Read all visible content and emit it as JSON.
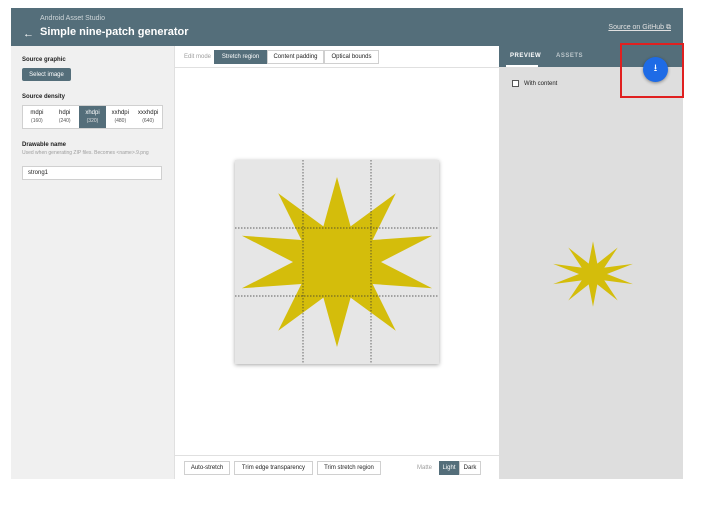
{
  "header": {
    "suite_title": "Android Asset Studio",
    "back_icon": "←",
    "title": "Simple nine-patch generator",
    "source_link": "Source on GitHub ⧉"
  },
  "left_panel": {
    "source_graphic_label": "Source graphic",
    "select_image_label": "Select image",
    "source_density_label": "Source density",
    "densities": [
      {
        "name": "mdpi",
        "dpi": "(160)"
      },
      {
        "name": "hdpi",
        "dpi": "(240)"
      },
      {
        "name": "xhdpi",
        "dpi": "(320)"
      },
      {
        "name": "xxhdpi",
        "dpi": "(480)"
      },
      {
        "name": "xxxhdpi",
        "dpi": "(640)"
      }
    ],
    "selected_density": "xhdpi",
    "drawable_name_label": "Drawable name",
    "drawable_help": "Used when generating ZIP files. Becomes <name>.9.png",
    "drawable_name_value": "strong1"
  },
  "editor": {
    "edit_mode_label": "Edit mode",
    "modes": [
      "Stretch region",
      "Content padding",
      "Optical bounds"
    ],
    "selected_mode": "Stretch region",
    "bottom_buttons": [
      "Auto-stretch",
      "Trim edge transparency",
      "Trim stretch region"
    ],
    "matte_label": "Matte",
    "matte_options": [
      "Light",
      "Dark"
    ],
    "selected_matte": "Light",
    "star_color": "#d4bd0b"
  },
  "preview": {
    "tabs": [
      "PREVIEW",
      "ASSETS"
    ],
    "active_tab": "PREVIEW",
    "with_content_label": "With content",
    "with_content_checked": false
  },
  "fab": {
    "icon": "download-icon",
    "glyph": "⭳",
    "color": "#1e6be6"
  },
  "colors": {
    "header": "#546e7a",
    "highlight": "#e02020"
  }
}
